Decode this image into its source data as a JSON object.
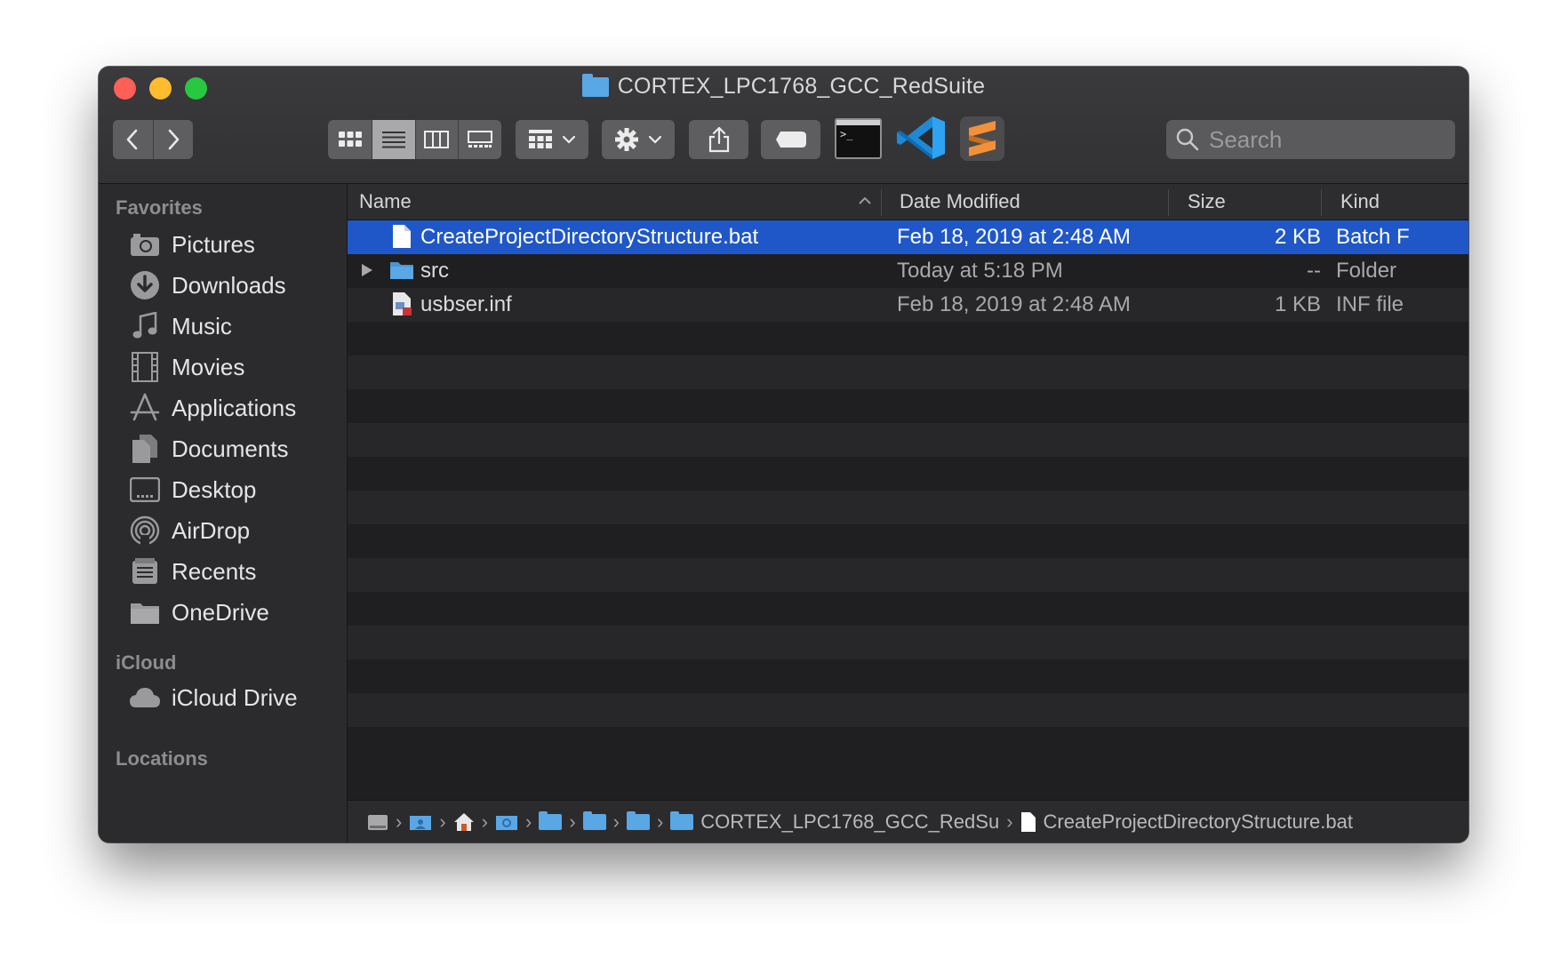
{
  "window": {
    "title": "CORTEX_LPC1768_GCC_RedSuite"
  },
  "toolbar": {
    "back_icon": "chevron-left-icon",
    "forward_icon": "chevron-right-icon",
    "search_placeholder": "Search"
  },
  "sidebar": {
    "sections": [
      {
        "title": "Favorites"
      },
      {
        "title": "iCloud"
      },
      {
        "title": "Locations"
      }
    ],
    "favorites": [
      {
        "label": "Pictures",
        "icon": "camera-icon"
      },
      {
        "label": "Downloads",
        "icon": "download-icon"
      },
      {
        "label": "Music",
        "icon": "music-note-icon"
      },
      {
        "label": "Movies",
        "icon": "film-icon"
      },
      {
        "label": "Applications",
        "icon": "applications-icon"
      },
      {
        "label": "Documents",
        "icon": "documents-icon"
      },
      {
        "label": "Desktop",
        "icon": "desktop-icon"
      },
      {
        "label": "AirDrop",
        "icon": "airdrop-icon"
      },
      {
        "label": "Recents",
        "icon": "recents-icon"
      },
      {
        "label": "OneDrive",
        "icon": "folder-icon"
      }
    ],
    "icloud": [
      {
        "label": "iCloud Drive",
        "icon": "cloud-icon"
      }
    ]
  },
  "columns": {
    "name": "Name",
    "date": "Date Modified",
    "size": "Size",
    "kind": "Kind"
  },
  "files": [
    {
      "name": "CreateProjectDirectoryStructure.bat",
      "date": "Feb 18, 2019 at 2:48 AM",
      "size": "2 KB",
      "kind": "Batch F"
    },
    {
      "name": "src",
      "date": "Today at 5:18 PM",
      "size": "--",
      "kind": "Folder"
    },
    {
      "name": "usbser.inf",
      "date": "Feb 18, 2019 at 2:48 AM",
      "size": "1 KB",
      "kind": "INF file"
    }
  ],
  "pathbar": {
    "folder": "CORTEX_LPC1768_GCC_RedSu",
    "file": "CreateProjectDirectoryStructure.bat"
  },
  "colors": {
    "selection": "#1f57c9",
    "folder": "#5aa7e6",
    "accent_orange": "#f2913a",
    "vscode_blue": "#1e8ad6"
  }
}
